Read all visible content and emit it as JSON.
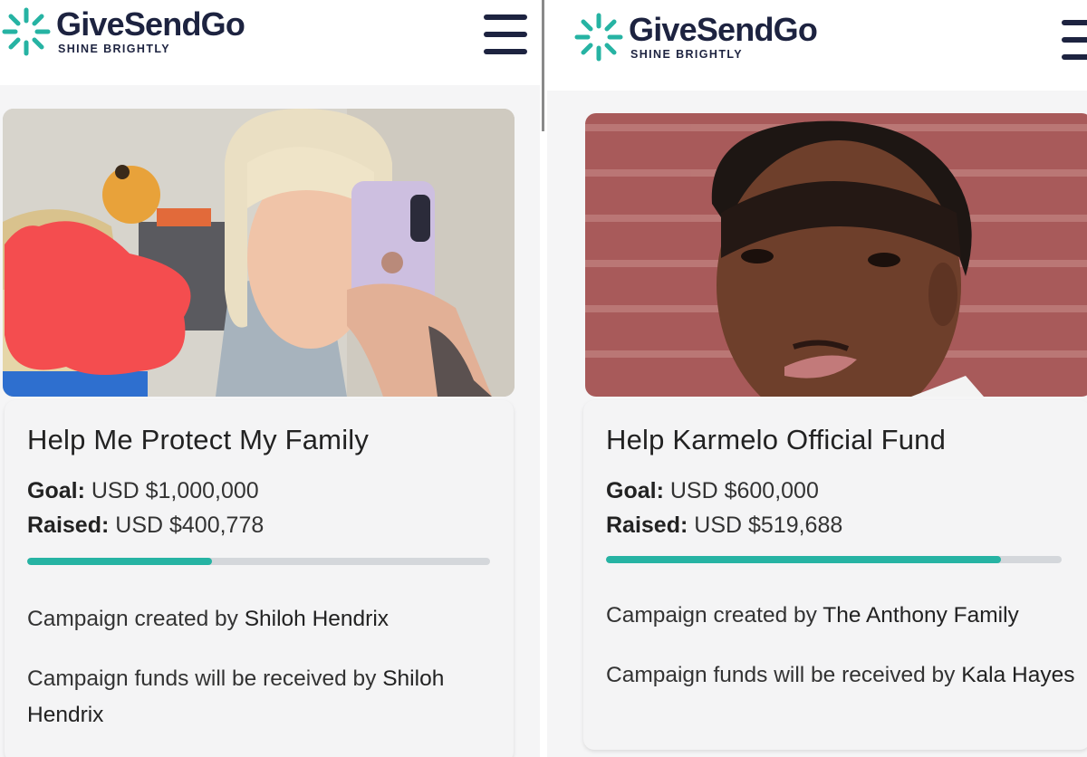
{
  "colors": {
    "brand_navy": "#1d2340",
    "accent_teal": "#26b3a3",
    "progress_track": "#d4d7db"
  },
  "screens": [
    {
      "brand": {
        "name": "GiveSendGo",
        "tagline": "SHINE BRIGHTLY",
        "icon": "sparkle-logo-icon"
      },
      "menu_icon": "hamburger-menu-icon",
      "photo": "campaign-photo",
      "campaign": {
        "title": "Help Me Protect My Family",
        "goal_label": "Goal:",
        "goal_value": "USD $1,000,000",
        "raised_label": "Raised:",
        "raised_value": "USD $400,778",
        "progress_fraction": 0.4,
        "creator_prefix": "Campaign created by",
        "creator_name": "Shiloh Hendrix",
        "recipient_prefix": "Campaign funds will be received by",
        "recipient_name": "Shiloh Hendrix"
      }
    },
    {
      "brand": {
        "name": "GiveSendGo",
        "tagline": "SHINE BRIGHTLY",
        "icon": "sparkle-logo-icon"
      },
      "menu_icon": "hamburger-menu-icon",
      "photo": "campaign-photo",
      "campaign": {
        "title": "Help Karmelo Official Fund",
        "goal_label": "Goal:",
        "goal_value": "USD $600,000",
        "raised_label": "Raised:",
        "raised_value": "USD $519,688",
        "progress_fraction": 0.866,
        "creator_prefix": "Campaign created by",
        "creator_name": "The Anthony Family",
        "recipient_prefix": "Campaign funds will be received by",
        "recipient_name": "Kala Hayes"
      }
    }
  ]
}
